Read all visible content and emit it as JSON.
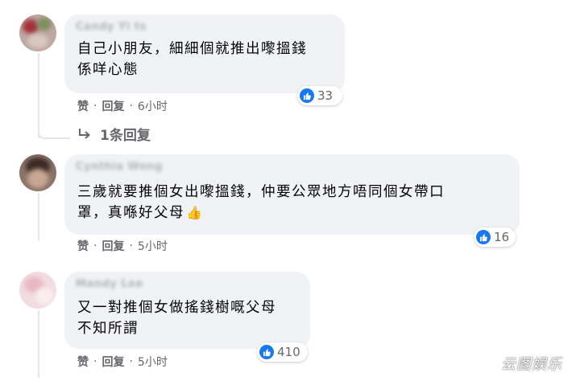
{
  "comments": [
    {
      "author": "Candy Yi ts",
      "text_lines": [
        "自己小朋友，細細個就推出嚟搵錢",
        "係咩心態"
      ],
      "reaction_count": "33",
      "like_label": "赞",
      "reply_label": "回复",
      "time": "6小时",
      "replies_link": "1条回复"
    },
    {
      "author": "Cynthia Wong",
      "text_lines": [
        "三歲就要推個女出嚟搵錢，仲要公眾地方唔同個女帶口",
        "罩，真喺好父母"
      ],
      "emoji": "👍",
      "reaction_count": "16",
      "like_label": "赞",
      "reply_label": "回复",
      "time": "5小时"
    },
    {
      "author": "Mandy Lee",
      "text_lines": [
        "又一對推個女做搖錢樹嘅父母",
        "不知所謂"
      ],
      "reaction_count": "410",
      "like_label": "赞",
      "reply_label": "回复",
      "time": "5小时"
    }
  ],
  "separator": "·",
  "watermark": "云图娱乐",
  "colors": {
    "bubble": "#f0f2f5",
    "like_blue": "#1877f2",
    "meta_gray": "#65676b",
    "text": "#050505"
  },
  "icons": [
    "like-icon",
    "reply-arrow-icon"
  ]
}
